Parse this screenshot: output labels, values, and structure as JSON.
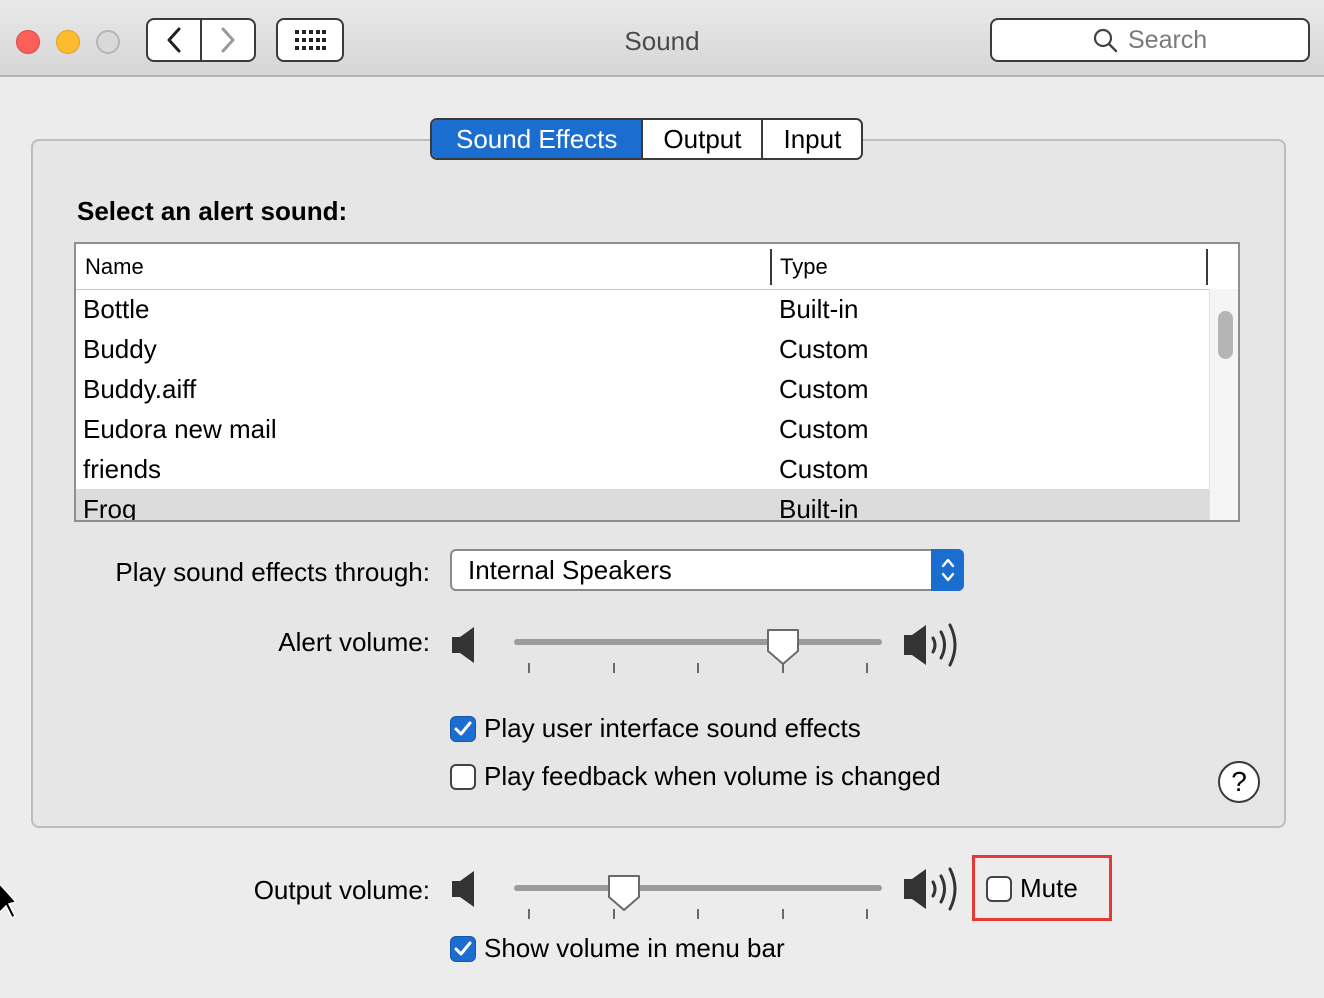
{
  "window": {
    "title": "Sound",
    "search_placeholder": "Search"
  },
  "tabs": [
    {
      "label": "Sound Effects",
      "active": true
    },
    {
      "label": "Output",
      "active": false
    },
    {
      "label": "Input",
      "active": false
    }
  ],
  "sound_effects": {
    "section_title": "Select an alert sound:",
    "columns": {
      "name": "Name",
      "type": "Type"
    },
    "rows": [
      {
        "name": "Bottle",
        "type": "Built-in",
        "selected": false
      },
      {
        "name": "Buddy",
        "type": "Custom",
        "selected": false
      },
      {
        "name": "Buddy.aiff",
        "type": "Custom",
        "selected": false
      },
      {
        "name": "Eudora new mail",
        "type": "Custom",
        "selected": false
      },
      {
        "name": "friends",
        "type": "Custom",
        "selected": false
      },
      {
        "name": "Frog",
        "type": "Built-in",
        "selected": true
      }
    ],
    "play_through_label": "Play sound effects through:",
    "play_through_value": "Internal Speakers",
    "alert_volume_label": "Alert volume:",
    "alert_volume_level": 0.73,
    "ui_sounds_label": "Play user interface sound effects",
    "ui_sounds_checked": true,
    "feedback_label": "Play feedback when volume is changed",
    "feedback_checked": false,
    "help_label": "?"
  },
  "output": {
    "volume_label": "Output volume:",
    "volume_level": 0.3,
    "mute_label": "Mute",
    "mute_checked": false,
    "show_in_menu_bar_label": "Show volume in menu bar",
    "show_in_menu_bar_checked": true
  },
  "colors": {
    "accent": "#1c6dd0",
    "highlight": "#e53935"
  }
}
